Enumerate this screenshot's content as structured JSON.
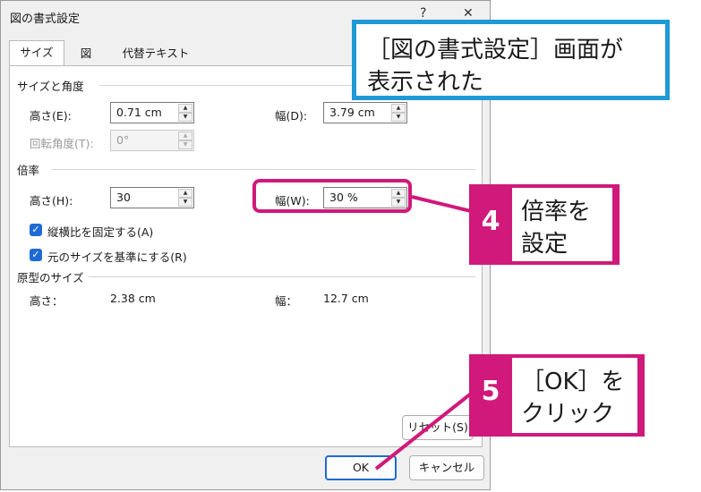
{
  "dialog": {
    "title": "図の書式設定",
    "help_glyph": "?",
    "close_glyph": "✕"
  },
  "tabs": [
    {
      "label": "サイズ"
    },
    {
      "label": "図"
    },
    {
      "label": "代替テキスト"
    }
  ],
  "size_rotation": {
    "heading": "サイズと角度",
    "height_label": "高さ(E):",
    "height_value": "0.71 cm",
    "width_label": "幅(D):",
    "width_value": "3.79 cm",
    "rotation_label": "回転角度(T):",
    "rotation_value": "0°"
  },
  "scale": {
    "heading": "倍率",
    "height_label": "高さ(H):",
    "height_value": "30",
    "width_label": "幅(W):",
    "width_value": "30 %",
    "lock_aspect_label": "縦横比を固定する(A)",
    "relative_original_label": "元のサイズを基準にする(R)",
    "check_glyph": "✓"
  },
  "original_size": {
    "heading": "原型のサイズ",
    "height_label": "高さ：",
    "height_value": "2.38 cm",
    "width_label": "幅：",
    "width_value": "12.7 cm"
  },
  "buttons": {
    "reset_label": "リセット(S)",
    "ok_label": "OK",
    "cancel_label": "キャンセル"
  },
  "annotations": {
    "top_callout_line1": "［図の書式設定］画面が",
    "top_callout_line2": "表示された",
    "step4_number": "4",
    "step4_line1": "倍率を",
    "step4_line2": "設定",
    "step5_number": "5",
    "step5_line1": "［OK］を",
    "step5_line2": "クリック"
  },
  "colors": {
    "callout_blue": "#1f9ad6",
    "highlight_magenta": "#d0197a",
    "checkbox_blue": "#1e6bd6"
  }
}
